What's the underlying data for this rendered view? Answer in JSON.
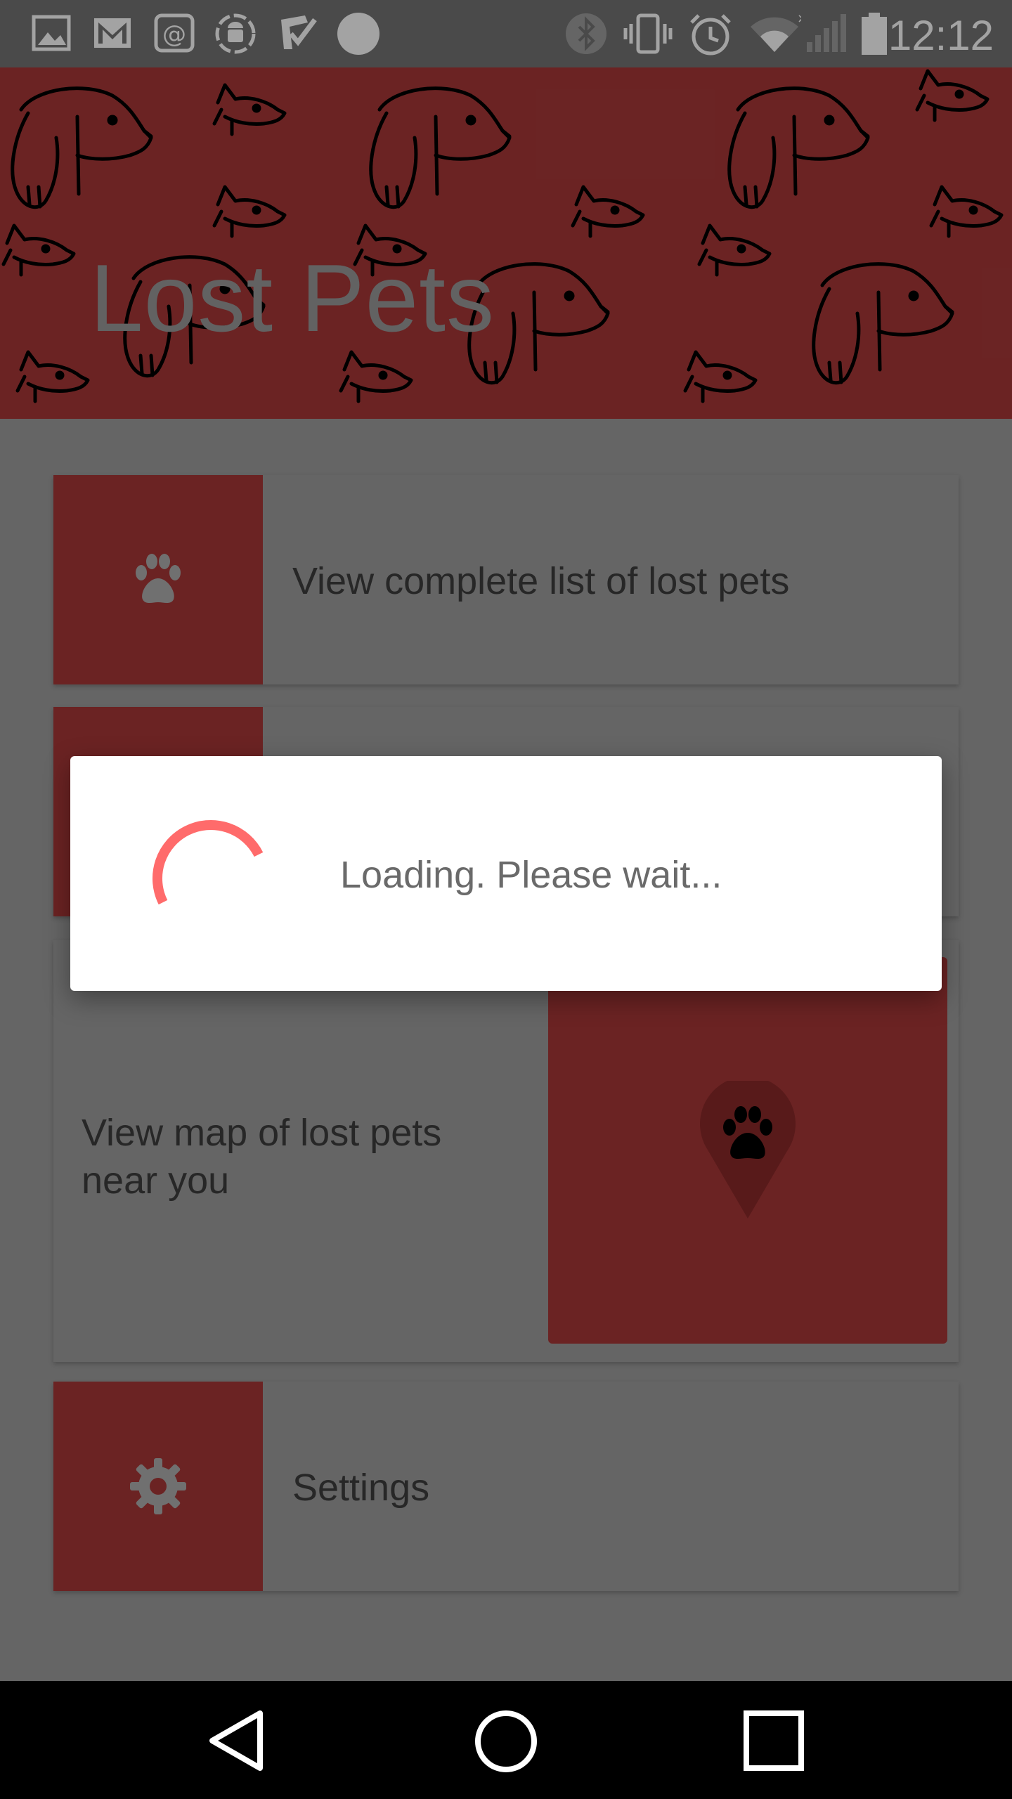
{
  "status_bar": {
    "time": "12:12",
    "left_icons": [
      "gallery-icon",
      "gmail-icon",
      "at-icon",
      "android-debug-icon",
      "task-check-icon",
      "circle-icon"
    ],
    "right_icons": [
      "bluetooth-icon",
      "vibrate-icon",
      "alarm-icon",
      "wifi-icon",
      "signal-icon",
      "battery-icon"
    ]
  },
  "header": {
    "title": "Lost Pets",
    "background_color": "#a83838"
  },
  "menu": {
    "list_label": "View complete list of lost pets",
    "map_label": "View map of lost pets near you",
    "settings_label": "Settings"
  },
  "dialog": {
    "message": "Loading. Please wait...",
    "spinner_color": "#ff6b6b"
  },
  "nav_bar": {
    "buttons": [
      "back-icon",
      "home-icon",
      "recents-icon"
    ]
  },
  "colors": {
    "accent": "#a83838",
    "card": "#9e9e9e",
    "dialog": "#ffffff"
  }
}
